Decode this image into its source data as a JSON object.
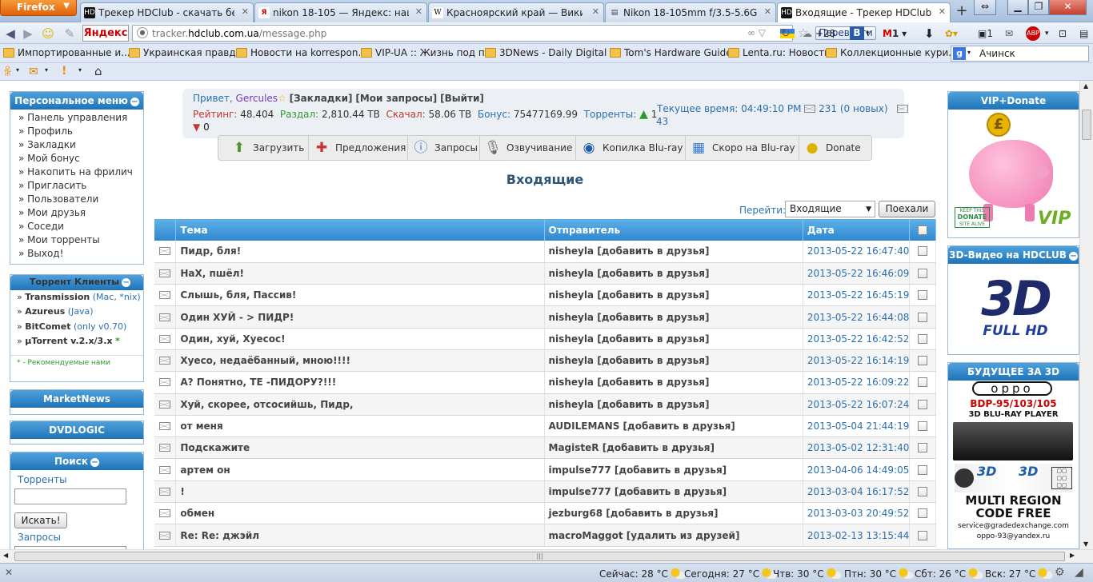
{
  "browser": {
    "menu_label": "Firefox",
    "tabs": [
      {
        "label": "Трекер HDClub - скачать бесп...",
        "icon": "HD"
      },
      {
        "label": "nikon 18-105 — Яндекс: нашл...",
        "icon": "Я"
      },
      {
        "label": "Красноярский край — Википе...",
        "icon": "W"
      },
      {
        "label": "Nikon 18-105mm f/3.5-5.6G AF...",
        "icon": "▤"
      },
      {
        "label": "Входящие - Трекер HDClub - ...",
        "icon": "HD"
      }
    ],
    "yandex_label": "Яндекс",
    "url_prefix": "tracker.",
    "url_host": "hdclub.com.ua",
    "url_path": "/message.php",
    "translate_label": "Перевести",
    "weather_temp": "+28",
    "mail_count": "1",
    "msg_count": "1",
    "google_search_value": "Ачинск",
    "bookmarks": [
      "Импортированные и...",
      "Украинская правда",
      "Новости на korrespon...",
      "VIP-UA :: Жизнь под п...",
      "3DNews - Daily Digital ...",
      "Tom's Hardware Guide",
      "Lenta.ru: Новости",
      "Коллекционные кури..."
    ]
  },
  "user": {
    "greeting": "Привет,",
    "name": "Gercules",
    "links": [
      "[Закладки]",
      "[Мои запросы]",
      "[Выйти]"
    ],
    "rating_label": "Рейтинг:",
    "rating": "48.404",
    "seed_label": "Раздал:",
    "seed": "2,810.44 TB",
    "down_label": "Скачал:",
    "down": "58.06 TB",
    "bonus_label": "Бонус:",
    "bonus": "75477169.99",
    "torrents_label": "Торренты:",
    "torrents_up": "1",
    "torrents_down": "0",
    "time_label": "Текущее время:",
    "time": "04:49:10 PM",
    "messages": "231 (0 новых)",
    "extra": "43"
  },
  "menu": [
    {
      "label": "Загрузить",
      "icon": "upload-arrow-icon"
    },
    {
      "label": "Предложения",
      "icon": "tools-icon"
    },
    {
      "label": "Запросы",
      "icon": "info-icon"
    },
    {
      "label": "Озвучивание",
      "icon": "microphone-icon"
    },
    {
      "label": "Копилка Blu-ray",
      "icon": "disc-icon"
    },
    {
      "label": "Скоро на Blu-ray",
      "icon": "calendar-icon"
    },
    {
      "label": "Donate",
      "icon": "coins-icon"
    }
  ],
  "sidebar": {
    "personal_title": "Персональное меню",
    "personal_items": [
      "» Панель управления",
      "» Профиль",
      "» Закладки",
      "» Мой бонус",
      "» Накопить на фрилич",
      "» Пригласить",
      "» Пользователи",
      "» Мои друзья",
      "» Соседи",
      "» Мои торренты",
      "» Выход!"
    ],
    "clients_title": "Торрент Клиенты",
    "clients": [
      {
        "name": "Transmission",
        "note": "(Mac, *nix)"
      },
      {
        "name": "Azureus",
        "note": "(Java)"
      },
      {
        "name": "BitComet",
        "note": "(only v0.70)"
      },
      {
        "name": "µTorrent v.2.x/3.x",
        "note": "*"
      }
    ],
    "clients_footnote": "* - Рекомендуемые нами",
    "market_title": "MarketNews",
    "dvd_title": "DVDLOGIC",
    "search_title": "Поиск",
    "search_torrents_label": "Торренты",
    "search_button": "Искать!",
    "search_requests_label": "Запросы"
  },
  "right": {
    "vip_title": "VIP+Donate",
    "vip_badge": "VIP",
    "vip_keep": "KEEP THIS",
    "vip_donate": "DONATE",
    "vip_alive": "SITE ALIVE",
    "td_title": "3D-Видео на HDCLUB",
    "td_big": "3D",
    "td_sub": "FULL HD",
    "fut_title": "БУДУЩЕЕ ЗА 3D",
    "oppo_logo": "oppo",
    "oppo_model": "BDP-95/103/105",
    "oppo_line": "3D BLU-RAY PLAYER",
    "oppo_mr1": "MULTI REGION",
    "oppo_mr2": "CODE FREE",
    "oppo_mail1": "service@gradedexchange.com",
    "oppo_mail2": "oppo-93@yandex.ru"
  },
  "inbox": {
    "title": "Входящие",
    "goto_label": "Перейти:",
    "goto_value": "Входящие",
    "go_button": "Поехали",
    "columns": [
      "Тема",
      "Отправитель",
      "Дата"
    ],
    "rows": [
      {
        "subject": "Пидр, бля!",
        "sender": "nisheyla [добавить в друзья]",
        "date": "2013-05-22 16:47:40"
      },
      {
        "subject": "НаХ, пшёл!",
        "sender": "nisheyla [добавить в друзья]",
        "date": "2013-05-22 16:46:09"
      },
      {
        "subject": "Слышь, бля, Пассив!",
        "sender": "nisheyla [добавить в друзья]",
        "date": "2013-05-22 16:45:19"
      },
      {
        "subject": "Один ХУЙ - > ПИДР!",
        "sender": "nisheyla [добавить в друзья]",
        "date": "2013-05-22 16:44:08"
      },
      {
        "subject": "Один, хуй, Хуесос!",
        "sender": "nisheyla [добавить в друзья]",
        "date": "2013-05-22 16:42:52"
      },
      {
        "subject": "Хуесо, недаёбанный, мною!!!!",
        "sender": "nisheyla [добавить в друзья]",
        "date": "2013-05-22 16:14:19"
      },
      {
        "subject": "А? Понятно, ТЕ -ПИДОРУ?!!!",
        "sender": "nisheyla [добавить в друзья]",
        "date": "2013-05-22 16:09:22"
      },
      {
        "subject": "Хуй, скорее, отсосийшь, Пидр,",
        "sender": "nisheyla [добавить в друзья]",
        "date": "2013-05-22 16:07:24"
      },
      {
        "subject": "от меня",
        "sender": "AUDILEMANS [добавить в друзья]",
        "date": "2013-05-04 21:44:19"
      },
      {
        "subject": "Подскажите",
        "sender": "MagisteR [добавить в друзья]",
        "date": "2013-05-02 12:31:40"
      },
      {
        "subject": "артем он",
        "sender": "impulse777 [добавить в друзья]",
        "date": "2013-04-06 14:49:05"
      },
      {
        "subject": "!",
        "sender": "impulse777 [добавить в друзья]",
        "date": "2013-03-04 16:17:52"
      },
      {
        "subject": "обмен",
        "sender": "jezburg68 [добавить в друзья]",
        "date": "2013-03-03 20:49:52"
      },
      {
        "subject": "Re: Re: джэйл",
        "sender": "macroMaggot [удалить из друзей]",
        "date": "2013-02-13 13:15:44"
      }
    ]
  },
  "status": {
    "weather": [
      {
        "label": "Сейчас: 28 °C"
      },
      {
        "label": "Сегодня: 27 °C"
      },
      {
        "label": "Чтв: 30 °C"
      },
      {
        "label": "Птн: 30 °C"
      },
      {
        "label": "Сбт: 26 °C"
      },
      {
        "label": "Вск: 27 °C"
      }
    ]
  }
}
